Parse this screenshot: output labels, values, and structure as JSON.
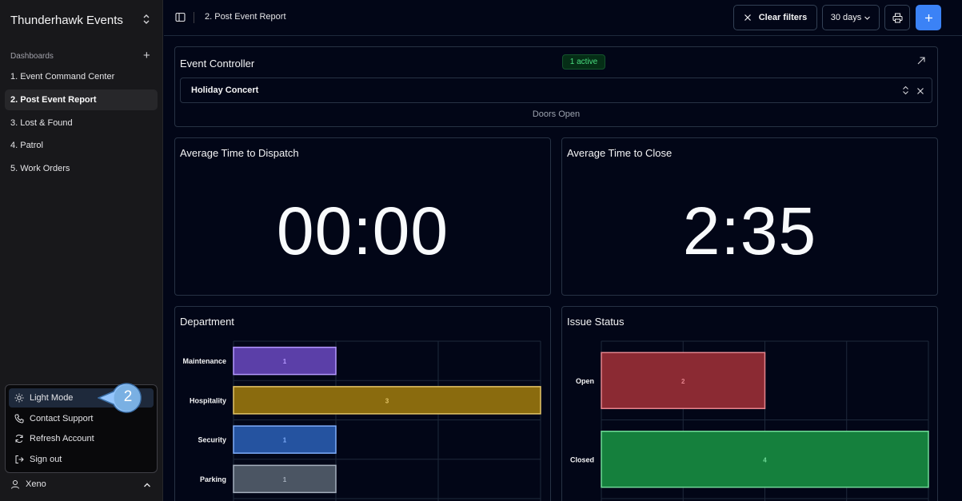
{
  "sidebar": {
    "brand": "Thunderhawk Events",
    "section_label": "Dashboards",
    "items": [
      {
        "label": "1. Event Command Center"
      },
      {
        "label": "2. Post Event Report"
      },
      {
        "label": "3. Lost & Found"
      },
      {
        "label": "4. Patrol"
      },
      {
        "label": "5. Work Orders"
      }
    ],
    "menu": [
      {
        "label": "Light Mode",
        "icon": "sun-icon"
      },
      {
        "label": "Contact Support",
        "icon": "phone-icon"
      },
      {
        "label": "Refresh Account",
        "icon": "refresh-icon"
      },
      {
        "label": "Sign out",
        "icon": "sign-out-icon"
      }
    ],
    "callout_number": "2",
    "user_name": "Xeno"
  },
  "topbar": {
    "breadcrumb": "2. Post Event Report",
    "clear_filters": "Clear filters",
    "range": "30 days"
  },
  "controller": {
    "title": "Event Controller",
    "badge": "1 active",
    "selected_event": "Holiday Concert",
    "status": "Doors Open"
  },
  "metrics": {
    "dispatch_title": "Average Time to Dispatch",
    "dispatch_value": "00:00",
    "close_title": "Average Time to Close",
    "close_value": "2:35"
  },
  "department": {
    "title": "Department"
  },
  "issue_status": {
    "title": "Issue Status"
  },
  "chart_data": [
    {
      "type": "bar",
      "orientation": "horizontal",
      "title": "Department",
      "categories": [
        "Maintenance",
        "Hospitality",
        "Security",
        "Parking"
      ],
      "values": [
        1,
        3,
        1,
        1
      ],
      "colors": [
        "#5b3fa8",
        "#8a6b0e",
        "#2553a0",
        "#4b5563"
      ],
      "xlim": [
        0,
        3
      ]
    },
    {
      "type": "bar",
      "orientation": "horizontal",
      "title": "Issue Status",
      "categories": [
        "Open",
        "Closed"
      ],
      "values": [
        2,
        4
      ],
      "colors": [
        "#8b2a33",
        "#15803d"
      ],
      "xlim": [
        0,
        4
      ]
    }
  ]
}
